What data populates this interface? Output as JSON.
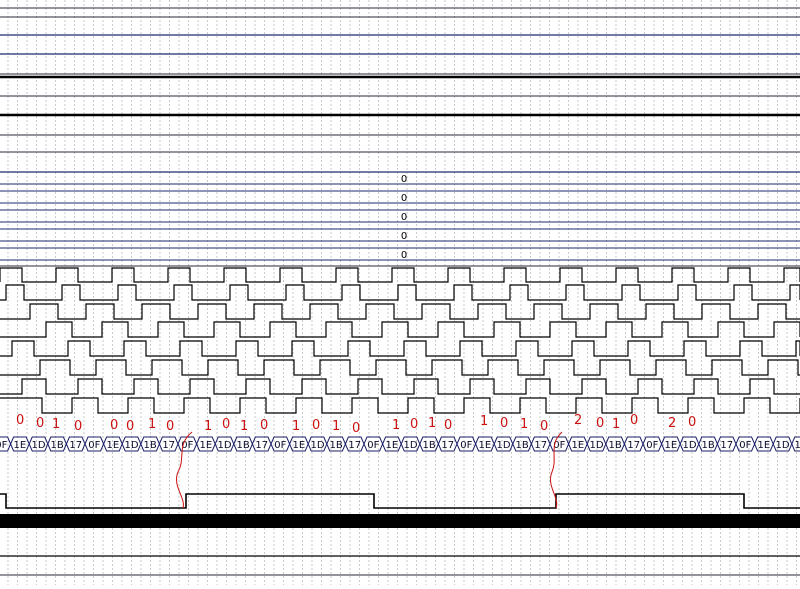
{
  "colors": {
    "background": "#ffffff",
    "grid": "#a8a8a8",
    "bus_line": "#1e2a6e",
    "signal": "#000000",
    "annotation": "#cc1111"
  },
  "bus_value_label": "0",
  "hex_bus_values": [
    "0F",
    "1E",
    "1D",
    "1B",
    "17"
  ],
  "annotation_digits": [
    "0",
    "0",
    "1",
    "0",
    "0",
    "0",
    "1",
    "0",
    "1",
    "0",
    "1",
    "0",
    "1",
    "0",
    "1",
    "0",
    "1",
    "0",
    "1",
    "0",
    "1",
    "0",
    "1",
    "0",
    "2",
    "0",
    "1",
    "0",
    "2",
    "0"
  ],
  "glitch_markers": [
    "glitch-marker-1",
    "glitch-marker-2"
  ]
}
